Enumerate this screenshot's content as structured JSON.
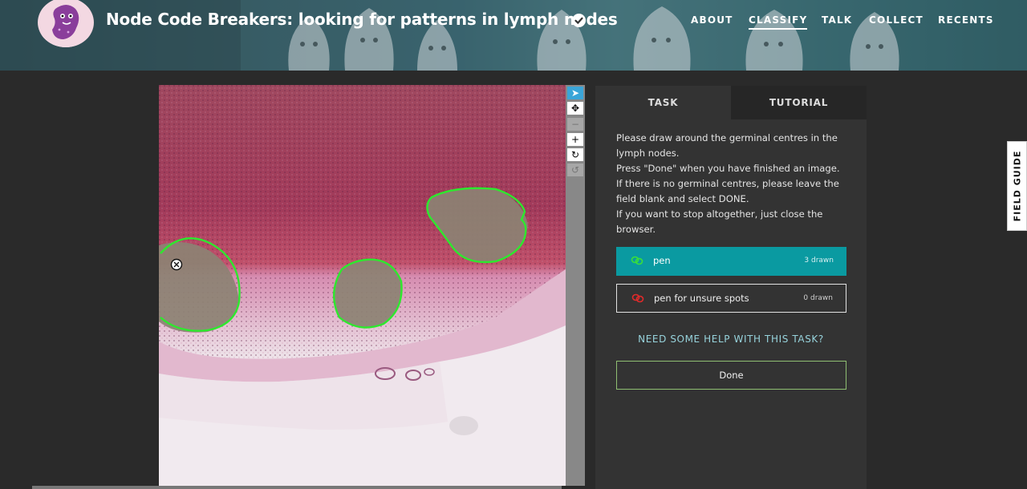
{
  "header": {
    "title": "Node Code Breakers: looking for patterns in lymph nodes",
    "logo_icon": "kidney-bean-mascot-icon",
    "logo_caption": "Node Code Breakers",
    "verified_icon": "check-badge-icon",
    "nav": [
      {
        "label": "ABOUT",
        "active": false
      },
      {
        "label": "CLASSIFY",
        "active": true
      },
      {
        "label": "TALK",
        "active": false
      },
      {
        "label": "COLLECT",
        "active": false
      },
      {
        "label": "RECENTS",
        "active": false
      }
    ]
  },
  "viewer": {
    "tools": [
      "pointer-icon",
      "move-icon",
      "zoom-out-icon",
      "zoom-in-icon",
      "rotate-icon",
      "reset-icon"
    ],
    "drawn_shapes": 3,
    "delete_icon": "delete-mark-icon"
  },
  "panel": {
    "tabs": [
      "TASK",
      "TUTORIAL"
    ],
    "active_tab": "TASK",
    "instructions": [
      "Please draw around the germinal centres in the lymph nodes.",
      "Press \"Done\" when you have finished an image.",
      "If there is no germinal centres, please leave the field blank and select DONE.",
      "If you want to stop altogether, just close the browser."
    ],
    "tools": [
      {
        "label": "pen",
        "count": "3 drawn",
        "color": "#3adf3a",
        "selected": true
      },
      {
        "label": "pen for unsure spots",
        "count": "0 drawn",
        "color": "#e02a2a",
        "selected": false
      }
    ],
    "help_label": "NEED SOME HELP WITH THIS TASK?",
    "done_label": "Done"
  },
  "field_guide": {
    "label": "FIELD GUIDE"
  },
  "colors": {
    "accent": "#0a9aa1",
    "help": "#97d3dc",
    "done_border": "#8fbf72",
    "drawing": "#2ee82e"
  }
}
